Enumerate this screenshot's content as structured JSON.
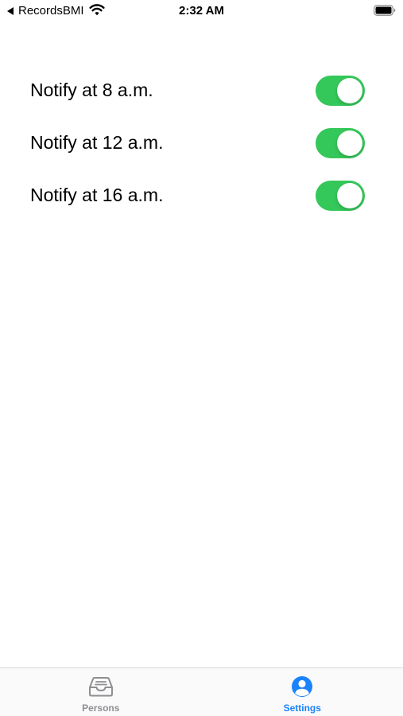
{
  "status_bar": {
    "back_app": "RecordsBMI",
    "time": "2:32 AM"
  },
  "settings": {
    "items": [
      {
        "label": "Notify at 8 a.m.",
        "enabled": true
      },
      {
        "label": "Notify at 12 a.m.",
        "enabled": true
      },
      {
        "label": "Notify at 16 a.m.",
        "enabled": true
      }
    ]
  },
  "tab_bar": {
    "tabs": [
      {
        "label": "Persons",
        "icon": "tray-icon",
        "active": false
      },
      {
        "label": "Settings",
        "icon": "person-circle-icon",
        "active": true
      }
    ]
  },
  "colors": {
    "toggle_on": "#34c759",
    "tab_active": "#1a82fb",
    "tab_inactive": "#8e8e93"
  }
}
